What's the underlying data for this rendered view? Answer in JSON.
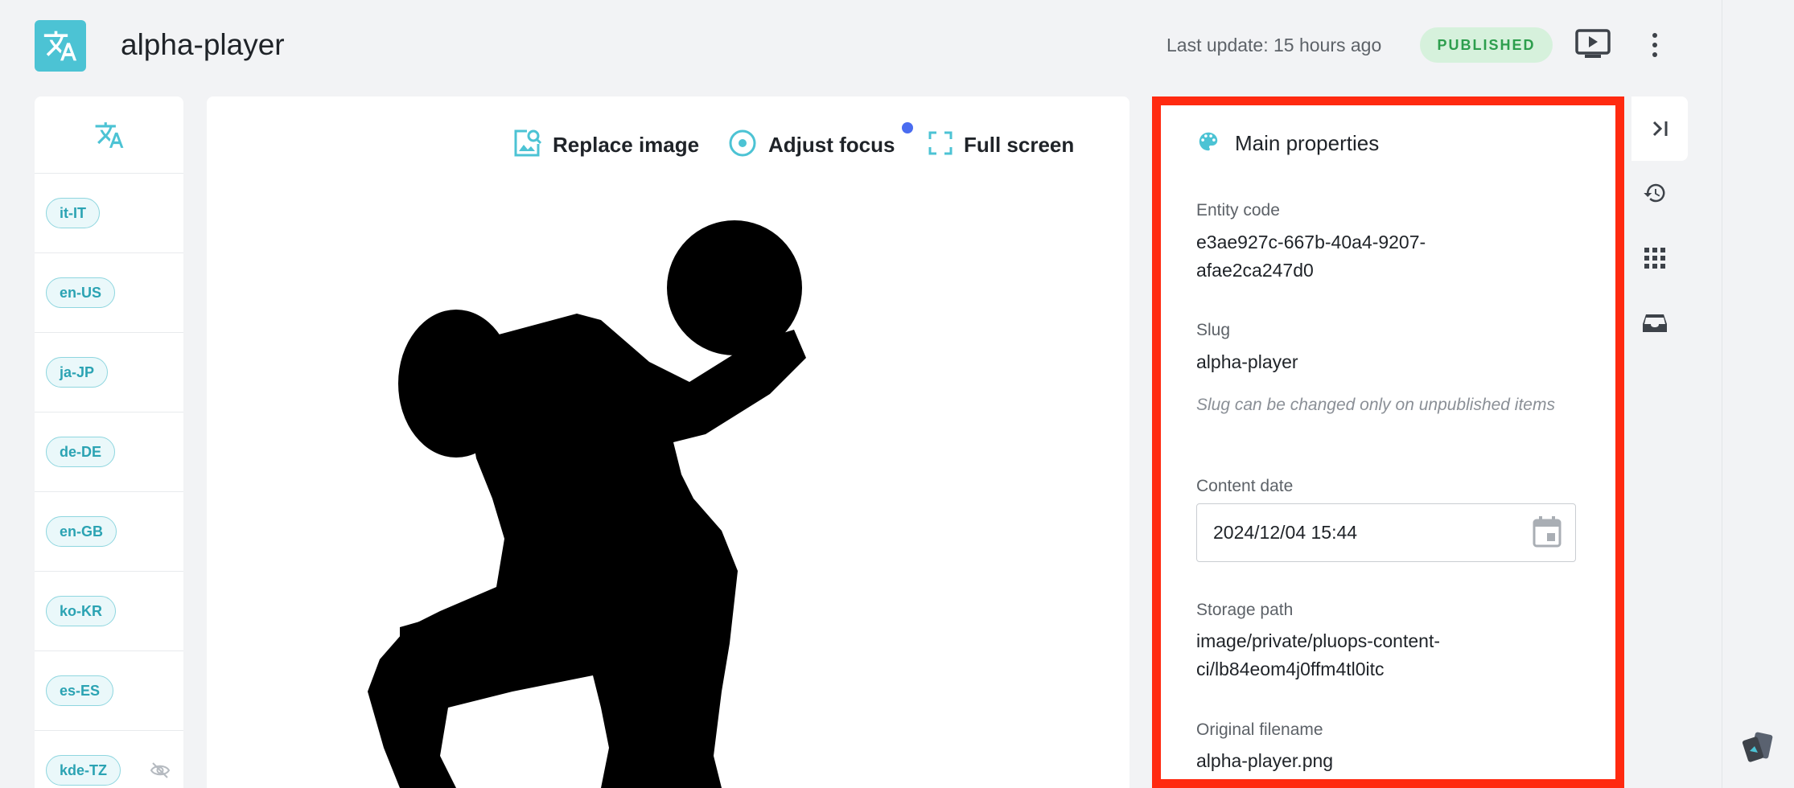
{
  "header": {
    "app_title": "alpha-player",
    "last_update": "Last update: 15 hours ago",
    "status_badge": "PUBLISHED"
  },
  "locales": [
    {
      "code": "it-IT",
      "hidden": false
    },
    {
      "code": "en-US",
      "hidden": false
    },
    {
      "code": "ja-JP",
      "hidden": false
    },
    {
      "code": "de-DE",
      "hidden": false
    },
    {
      "code": "en-GB",
      "hidden": false
    },
    {
      "code": "ko-KR",
      "hidden": false
    },
    {
      "code": "es-ES",
      "hidden": false
    },
    {
      "code": "kde-TZ",
      "hidden": true
    }
  ],
  "toolbar": {
    "replace_label": "Replace image",
    "focus_label": "Adjust focus",
    "fullscreen_label": "Full screen"
  },
  "properties": {
    "title": "Main properties",
    "entity_code_label": "Entity code",
    "entity_code_line1": "e3ae927c-667b-40a4-9207-",
    "entity_code_line2": "afae2ca247d0",
    "slug_label": "Slug",
    "slug_value": "alpha-player",
    "slug_hint": "Slug can be changed only on unpublished items",
    "content_date_label": "Content date",
    "content_date_value": "2024/12/04 15:44",
    "storage_path_label": "Storage path",
    "storage_path_line1": "image/private/pluops-content-",
    "storage_path_line2": "ci/lb84eom4j0ffm4tl0itc",
    "original_filename_label": "Original filename",
    "original_filename_value": "alpha-player.png"
  },
  "colors": {
    "accent": "#4cc3d4",
    "published_bg": "#d6f1dc",
    "published_text": "#2d9e4d",
    "highlight_border": "#ff2a10",
    "notification_dot": "#4a6cf0"
  },
  "icons": [
    "translate-icon",
    "preview-icon",
    "more-vert-icon",
    "image-search-icon",
    "focus-target-icon",
    "fullscreen-icon",
    "palette-icon",
    "calendar-icon",
    "collapse-right-icon",
    "history-icon",
    "apps-grid-icon",
    "inbox-icon",
    "eye-off-icon",
    "cards-icon"
  ]
}
